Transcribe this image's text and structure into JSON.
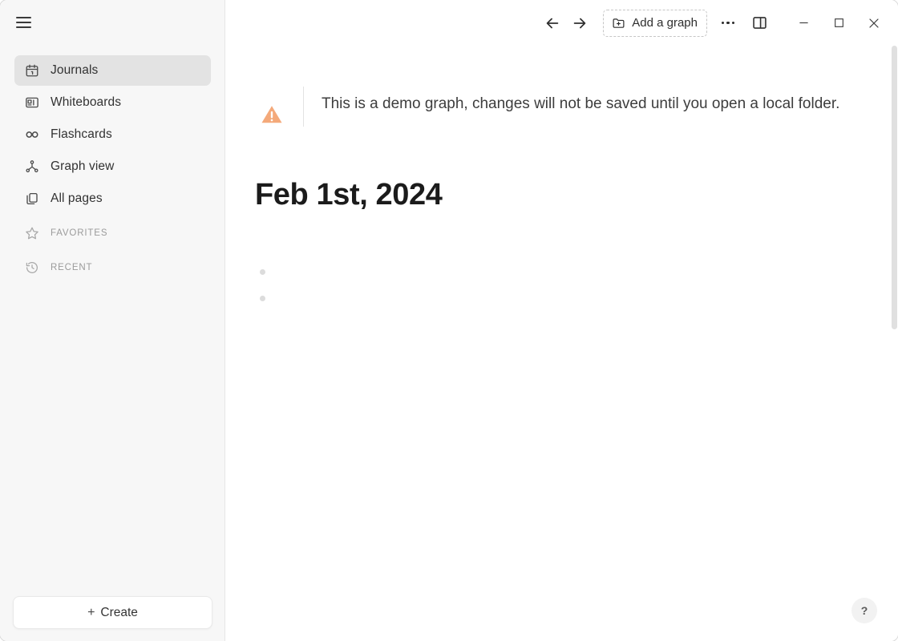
{
  "app": {
    "name": "Logseq",
    "accent_warning_color": "#f2a676",
    "sidebar_bg": "#f7f7f7",
    "active_item_bg": "#e3e3e3"
  },
  "sidebar": {
    "menu_toggle_name": "hamburger-menu",
    "items": [
      {
        "label": "Journals",
        "icon": "calendar-icon",
        "active": true,
        "type": "nav"
      },
      {
        "label": "Whiteboards",
        "icon": "whiteboard-icon",
        "active": false,
        "type": "nav"
      },
      {
        "label": "Flashcards",
        "icon": "infinity-icon",
        "active": false,
        "type": "nav"
      },
      {
        "label": "Graph view",
        "icon": "graph-icon",
        "active": false,
        "type": "nav"
      },
      {
        "label": "All pages",
        "icon": "pages-icon",
        "active": false,
        "type": "nav"
      },
      {
        "label": "FAVORITES",
        "icon": "star-icon",
        "active": false,
        "type": "section"
      },
      {
        "label": "RECENT",
        "icon": "history-icon",
        "active": false,
        "type": "section"
      }
    ],
    "create_button": {
      "label": "Create",
      "plus": "+"
    }
  },
  "toolbar": {
    "back_icon": "arrow-left-icon",
    "forward_icon": "arrow-right-icon",
    "add_graph_label": "Add a graph",
    "add_graph_icon": "folder-plus-icon",
    "more_icon": "more-horizontal-icon",
    "right_sidebar_icon": "right-sidebar-toggle-icon",
    "window_minimize": "minimize-icon",
    "window_maximize": "maximize-icon",
    "window_close": "close-icon"
  },
  "banner": {
    "icon": "warning-triangle-icon",
    "message": "This is a demo graph, changes will not be saved until you open a local folder."
  },
  "journal": {
    "title": "Feb 1st, 2024",
    "blocks": [
      {
        "text": ""
      },
      {
        "text": ""
      }
    ]
  },
  "help": {
    "label": "?"
  },
  "scrollbar": {
    "orientation": "vertical"
  }
}
